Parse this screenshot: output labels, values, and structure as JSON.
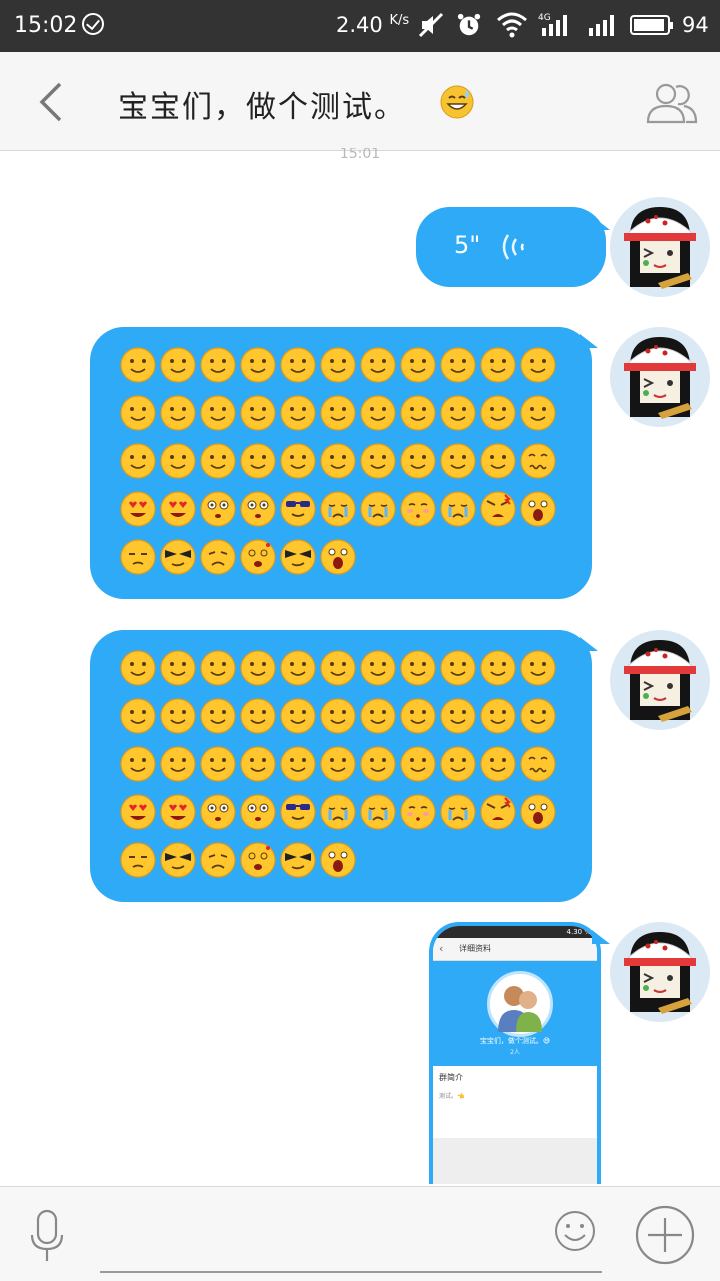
{
  "status_bar": {
    "time": "15:02",
    "net_speed": "2.40",
    "net_unit": "K/s",
    "network": "4G",
    "battery": "94",
    "icons": [
      "check-circle-icon",
      "mute-icon",
      "alarm-icon",
      "wifi-icon",
      "signal-4g-icon",
      "signal-icon",
      "battery-icon"
    ]
  },
  "header": {
    "title": "宝宝们，做个测试。",
    "title_emoji": "sweat-smile-emoji",
    "back_icon": "back-icon",
    "members_icon": "group-members-icon"
  },
  "chat": {
    "timestamp": "15:01",
    "voice_message": {
      "duration": "5\"",
      "icon": "voice-waves-icon"
    },
    "emoji_messages": [
      {
        "emojis": [
          "smile",
          "smile",
          "smile",
          "smile",
          "smile",
          "smile",
          "smile",
          "smile",
          "smile",
          "smile",
          "smile",
          "smile",
          "smile",
          "smile",
          "smile",
          "smile",
          "smile",
          "smile",
          "smile",
          "smile",
          "smile",
          "smile",
          "smile",
          "smile",
          "smile",
          "smile",
          "smile",
          "smile",
          "smile",
          "smile",
          "smile",
          "smile",
          "wavy",
          "love",
          "love",
          "shock",
          "shock",
          "cool",
          "cry",
          "cry",
          "shy",
          "cry",
          "angry",
          "scream",
          "proud",
          "swag",
          "frown",
          "dizzy",
          "swag",
          "scream"
        ]
      },
      {
        "emojis": [
          "smile",
          "smile",
          "smile",
          "smile",
          "smile",
          "smile",
          "smile",
          "smile",
          "smile",
          "smile",
          "smile",
          "smile",
          "smile",
          "smile",
          "smile",
          "smile",
          "smile",
          "smile",
          "smile",
          "smile",
          "smile",
          "smile",
          "smile",
          "smile",
          "smile",
          "smile",
          "smile",
          "smile",
          "smile",
          "smile",
          "smile",
          "smile",
          "wavy",
          "love",
          "love",
          "shock",
          "shock",
          "cool",
          "cry",
          "cry",
          "shy",
          "cry",
          "angry",
          "scream",
          "proud",
          "swag",
          "frown",
          "dizzy",
          "swag",
          "scream"
        ]
      }
    ],
    "image_message": {
      "mini_status": "4.30 %",
      "mini_title": "详细资料",
      "mini_name": "宝宝们，做个测试。😅",
      "mini_count": "2人",
      "mini_section": "群简介",
      "mini_desc": "测试。👈"
    }
  },
  "input_bar": {
    "placeholder": "",
    "mic_icon": "microphone-icon",
    "emoji_icon": "smiley-icon",
    "plus_icon": "plus-icon"
  },
  "colors": {
    "bubble": "#2eaaf6",
    "statusbar": "#333333",
    "header": "#f6f6f6"
  }
}
